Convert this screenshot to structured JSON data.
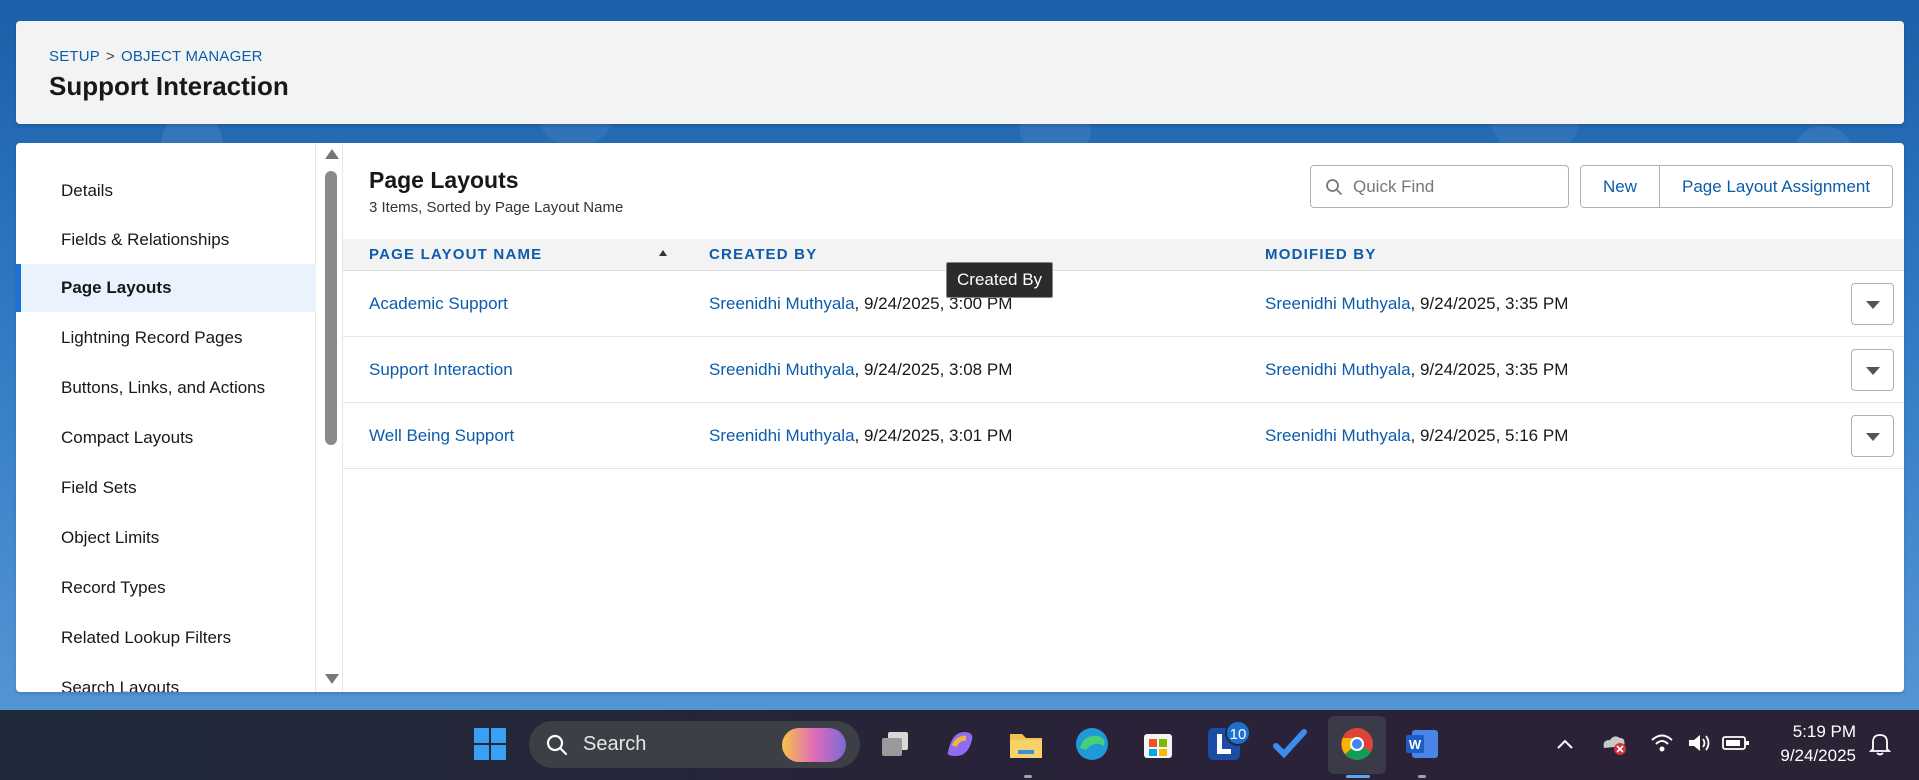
{
  "header": {
    "breadcrumb": [
      "SETUP",
      "OBJECT MANAGER"
    ],
    "breadcrumb_separator": ">",
    "title": "Support Interaction"
  },
  "sidebar": {
    "items": [
      {
        "label": "Details",
        "active": false
      },
      {
        "label": "Fields & Relationships",
        "active": false
      },
      {
        "label": "Page Layouts",
        "active": true
      },
      {
        "label": "Lightning Record Pages",
        "active": false
      },
      {
        "label": "Buttons, Links, and Actions",
        "active": false
      },
      {
        "label": "Compact Layouts",
        "active": false
      },
      {
        "label": "Field Sets",
        "active": false
      },
      {
        "label": "Object Limits",
        "active": false
      },
      {
        "label": "Record Types",
        "active": false
      },
      {
        "label": "Related Lookup Filters",
        "active": false
      },
      {
        "label": "Search Layouts",
        "active": false
      }
    ]
  },
  "main": {
    "title": "Page Layouts",
    "subtitle": "3 Items, Sorted by Page Layout Name",
    "quick_find_placeholder": "Quick Find",
    "buttons": {
      "new": "New",
      "assignment": "Page Layout Assignment"
    },
    "columns": [
      "PAGE LAYOUT NAME",
      "CREATED BY",
      "MODIFIED BY"
    ],
    "rows": [
      {
        "name": "Academic Support",
        "created_user": "Sreenidhi Muthyala",
        "created_date": ", 9/24/2025, 3:00 PM",
        "modified_user": "Sreenidhi Muthyala",
        "modified_date": ", 9/24/2025, 3:35 PM"
      },
      {
        "name": "Support Interaction",
        "created_user": "Sreenidhi Muthyala",
        "created_date": ", 9/24/2025, 3:08 PM",
        "modified_user": "Sreenidhi Muthyala",
        "modified_date": ", 9/24/2025, 3:35 PM"
      },
      {
        "name": "Well Being Support",
        "created_user": "Sreenidhi Muthyala",
        "created_date": ", 9/24/2025, 3:01 PM",
        "modified_user": "Sreenidhi Muthyala",
        "modified_date": ", 9/24/2025, 5:16 PM"
      }
    ],
    "tooltip": "Created By"
  },
  "taskbar": {
    "search_label": "Search",
    "notification_badge": "10",
    "time": "5:19 PM",
    "date": "9/24/2025",
    "icons": [
      "windows-start-icon",
      "task-view-icon",
      "copilot-icon",
      "file-explorer-icon",
      "edge-icon",
      "microsoft-store-icon",
      "app-l-icon",
      "todo-icon",
      "chrome-icon",
      "word-icon"
    ],
    "tray": [
      "chevron-up-icon",
      "onedrive-error-icon",
      "wifi-icon",
      "volume-icon",
      "battery-icon",
      "notification-bell-icon"
    ]
  },
  "colors": {
    "accent": "#0b5cab",
    "active_border": "#1b70d1",
    "active_bg": "#eaf3fd"
  }
}
